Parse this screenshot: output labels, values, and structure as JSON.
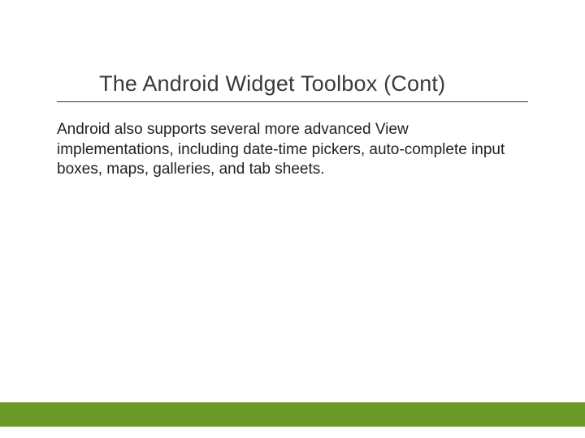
{
  "slide": {
    "title": "The Android Widget Toolbox (Cont)",
    "body": "Android also supports several more advanced View implementations, including date-time pickers, auto-complete input boxes, maps, galleries, and tab sheets."
  },
  "colors": {
    "footer": "#6a9a28"
  }
}
